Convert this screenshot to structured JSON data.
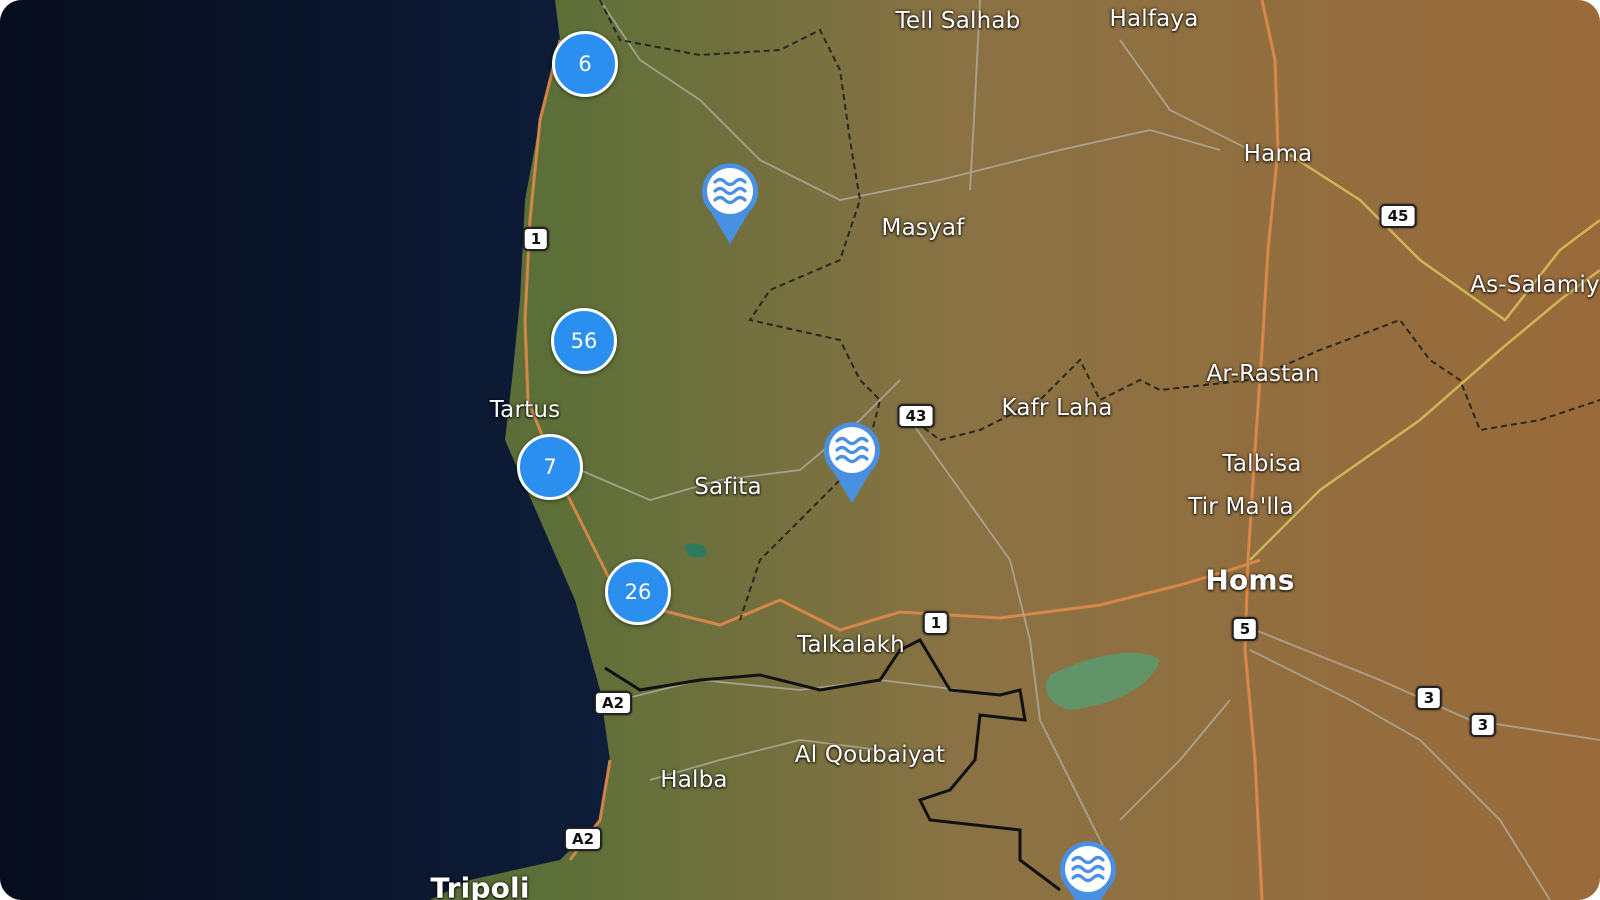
{
  "map": {
    "colors": {
      "sea": "#0a1326",
      "land": "#7a6a3e",
      "cluster": "#2b8ff0",
      "pin": "#4a90e2"
    },
    "places": [
      {
        "name": "Tell Salhab"
      },
      {
        "name": "Halfaya"
      },
      {
        "name": "Hama"
      },
      {
        "name": "Masyaf"
      },
      {
        "name": "As-Salamiy"
      },
      {
        "name": "Tartus"
      },
      {
        "name": "Ar-Rastan"
      },
      {
        "name": "Kafr Laha"
      },
      {
        "name": "Safita"
      },
      {
        "name": "Talbisa"
      },
      {
        "name": "Tir Ma'lla"
      },
      {
        "name": "Homs"
      },
      {
        "name": "Talkalakh"
      },
      {
        "name": "Al Qoubaiyat"
      },
      {
        "name": "Halba"
      },
      {
        "name": "Tripoli"
      }
    ],
    "road_shields": [
      {
        "label": "1"
      },
      {
        "label": "43"
      },
      {
        "label": "45"
      },
      {
        "label": "1"
      },
      {
        "label": "5"
      },
      {
        "label": "3"
      },
      {
        "label": "3"
      },
      {
        "label": "A2"
      },
      {
        "label": "A2"
      }
    ],
    "clusters": [
      {
        "count": "6"
      },
      {
        "count": "56"
      },
      {
        "count": "7"
      },
      {
        "count": "26"
      }
    ],
    "water_markers": [
      {
        "icon": "waves-icon"
      },
      {
        "icon": "waves-icon"
      },
      {
        "icon": "waves-icon"
      }
    ]
  }
}
